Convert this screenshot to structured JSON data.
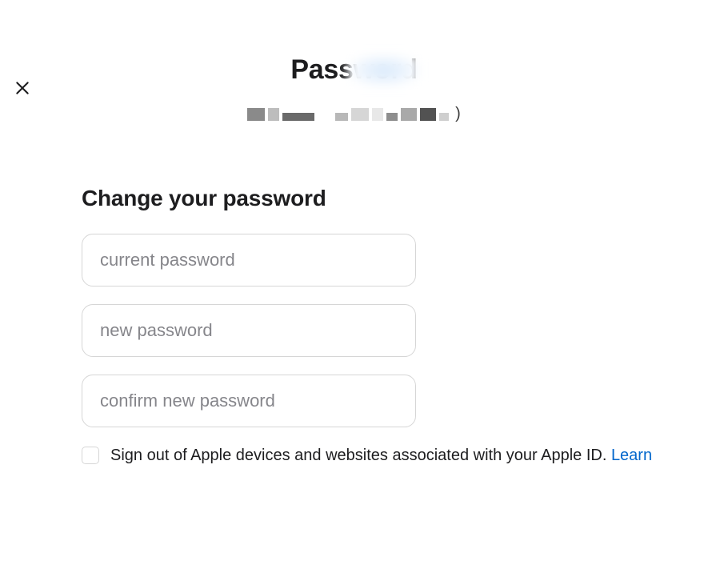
{
  "header": {
    "title": "Password",
    "trail": ")"
  },
  "section": {
    "title": "Change your password"
  },
  "fields": {
    "current_placeholder": "current password",
    "new_placeholder": "new password",
    "confirm_placeholder": "confirm new password"
  },
  "checkbox": {
    "label_prefix": "Sign out of Apple devices and websites associated with your Apple ID. ",
    "learn_link": "Learn"
  }
}
